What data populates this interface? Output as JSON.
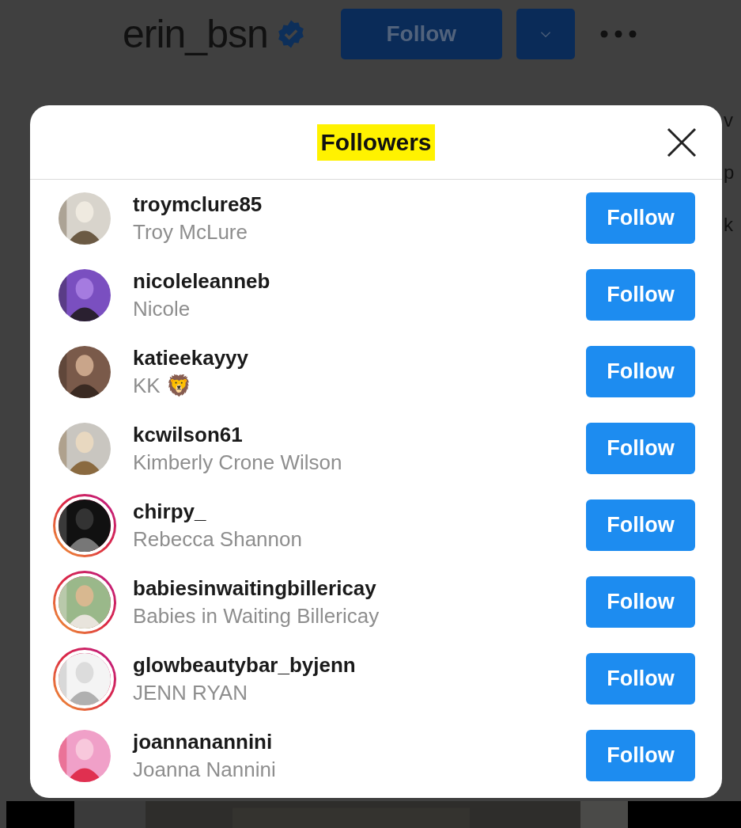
{
  "profile": {
    "username": "erin_bsn",
    "verified": true,
    "follow_button": "Follow"
  },
  "edge_fragments": [
    "v",
    "p",
    "k"
  ],
  "dialog": {
    "title": "Followers",
    "title_highlighted": true,
    "followers": [
      {
        "username": "troymclure85",
        "name": "Troy McLure",
        "story_ring": false,
        "button": "Follow"
      },
      {
        "username": "nicoleleanneb",
        "name": "Nicole",
        "story_ring": false,
        "button": "Follow"
      },
      {
        "username": "katieekayyy",
        "name": "KK 🦁",
        "story_ring": false,
        "button": "Follow"
      },
      {
        "username": "kcwilson61",
        "name": "Kimberly Crone Wilson",
        "story_ring": false,
        "button": "Follow"
      },
      {
        "username": "chirpy_",
        "name": "Rebecca Shannon",
        "story_ring": true,
        "button": "Follow"
      },
      {
        "username": "babiesinwaitingbillericay",
        "name": "Babies in Waiting Billericay",
        "story_ring": true,
        "button": "Follow"
      },
      {
        "username": "glowbeautybar_byjenn",
        "name": "JENN RYAN",
        "story_ring": true,
        "button": "Follow"
      },
      {
        "username": "joannanannini",
        "name": "Joanna Nannini",
        "story_ring": false,
        "button": "Follow"
      }
    ]
  }
}
